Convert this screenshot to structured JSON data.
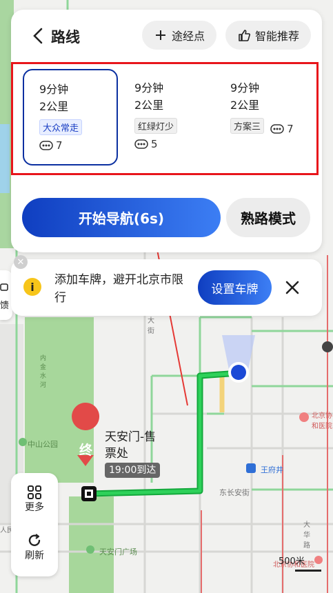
{
  "header": {
    "title": "路线",
    "waypoint_label": "途经点",
    "smart_label": "智能推荐"
  },
  "routes": [
    {
      "time": "9分钟",
      "distance": "2公里",
      "tag": "大众常走",
      "lights": "7",
      "selected": true
    },
    {
      "time": "9分钟",
      "distance": "2公里",
      "tag": "红绿灯少",
      "lights": "5",
      "selected": false
    },
    {
      "time": "9分钟",
      "distance": "2公里",
      "tag": "方案三",
      "lights": "7",
      "selected": false
    }
  ],
  "actions": {
    "start_nav": "开始导航(6s)",
    "familiar": "熟路模式"
  },
  "banner": {
    "text": "添加车牌，避开北京市限行",
    "button": "设置车牌"
  },
  "edge_tab": {
    "label": "馈"
  },
  "destination": {
    "badge": "终",
    "name": "天安门-售票处",
    "arrival": "19:00到达"
  },
  "side_tools": {
    "more": "更多",
    "refresh": "刷新"
  },
  "map_labels": {
    "zhongshan_park": "中山公园",
    "tiananmen_square": "天安门广场",
    "wangfujing": "王府井",
    "dong_changan": "东长安街",
    "hospital": "北京协和医院",
    "dajie": "大街",
    "dahua": "大华路",
    "beijing_zhang": "北京",
    "bottom_label": "北京协和医院",
    "left_label": "人民",
    "neichang": "内金水河"
  },
  "scale": {
    "label": "500米"
  },
  "colors": {
    "accent": "#1a4fd8",
    "route": "#1db954",
    "highlight_box": "#e8151b",
    "arrow": "#e53935"
  }
}
